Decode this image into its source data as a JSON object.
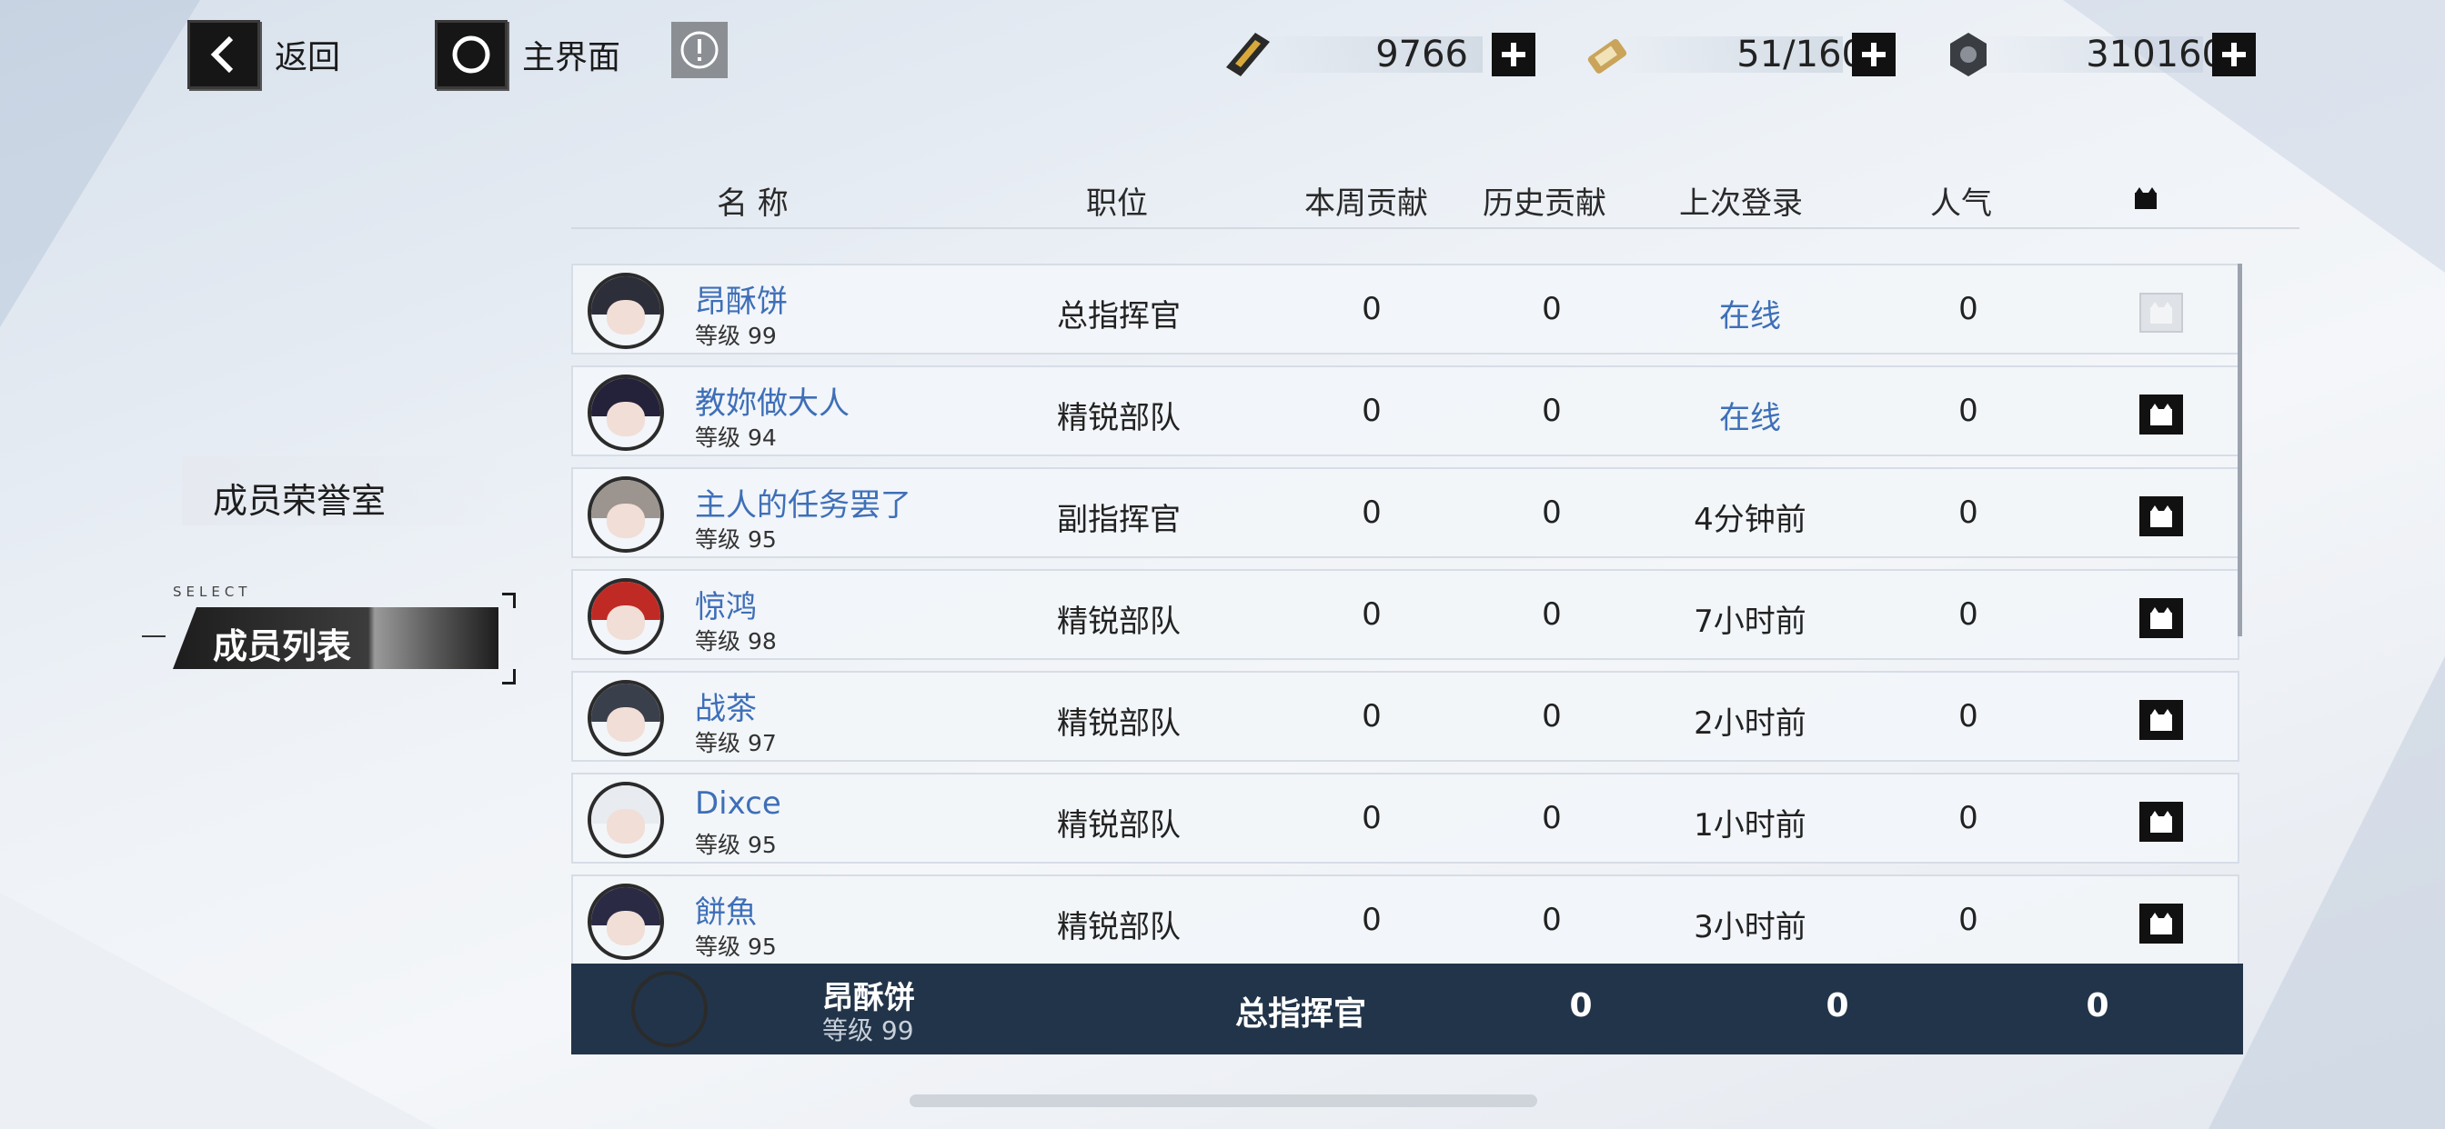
{
  "nav": {
    "back_label": "返回",
    "home_label": "主界面"
  },
  "resources": [
    {
      "icon": "gold-ticket-icon",
      "value": "9766"
    },
    {
      "icon": "battery-icon",
      "value": "51/160"
    },
    {
      "icon": "hex-nut-icon",
      "value": "310160"
    }
  ],
  "sidebar": {
    "items": [
      {
        "label": "成员荣誉室",
        "selected": false
      },
      {
        "label": "成员列表",
        "selected": true
      }
    ],
    "select_tag": "SELECT"
  },
  "table": {
    "headers": {
      "name": "名  称",
      "position": "职位",
      "weekly": "本周贡献",
      "history": "历史贡献",
      "last_login": "上次登录",
      "popularity": "人气",
      "gift_icon": "gift-icon"
    },
    "rows": [
      {
        "name": "昂酥饼",
        "level": "等级 99",
        "position": "总指挥官",
        "weekly": "0",
        "history": "0",
        "last_login": "在线",
        "online": true,
        "popularity": "0",
        "gift_enabled": false,
        "hair": "#2c2f3a"
      },
      {
        "name": "教妳做大人",
        "level": "等级 94",
        "position": "精锐部队",
        "weekly": "0",
        "history": "0",
        "last_login": "在线",
        "online": true,
        "popularity": "0",
        "gift_enabled": true,
        "hair": "#24223a"
      },
      {
        "name": "主人的任务罢了",
        "level": "等级 95",
        "position": "副指挥官",
        "weekly": "0",
        "history": "0",
        "last_login": "4分钟前",
        "online": false,
        "popularity": "0",
        "gift_enabled": true,
        "hair": "#9c958f"
      },
      {
        "name": "惊鸿",
        "level": "等级 98",
        "position": "精锐部队",
        "weekly": "0",
        "history": "0",
        "last_login": "7小时前",
        "online": false,
        "popularity": "0",
        "gift_enabled": true,
        "hair": "#c02a25"
      },
      {
        "name": "战茶",
        "level": "等级 97",
        "position": "精锐部队",
        "weekly": "0",
        "history": "0",
        "last_login": "2小时前",
        "online": false,
        "popularity": "0",
        "gift_enabled": true,
        "hair": "#3a3f4c"
      },
      {
        "name": "Dixce",
        "level": "等级 95",
        "position": "精锐部队",
        "weekly": "0",
        "history": "0",
        "last_login": "1小时前",
        "online": false,
        "popularity": "0",
        "gift_enabled": true,
        "hair": "#e8ebef"
      },
      {
        "name": "餅魚",
        "level": "等级 95",
        "position": "精锐部队",
        "weekly": "0",
        "history": "0",
        "last_login": "3小时前",
        "online": false,
        "popularity": "0",
        "gift_enabled": true,
        "hair": "#2b2a44"
      }
    ]
  },
  "self_row": {
    "name": "昂酥饼",
    "level": "等级 99",
    "position": "总指挥官",
    "weekly": "0",
    "history": "0",
    "popularity": "0"
  }
}
